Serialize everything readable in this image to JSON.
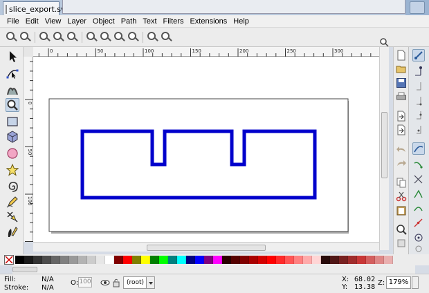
{
  "window": {
    "tab_title": "slice_export.svg"
  },
  "menu": [
    "File",
    "Edit",
    "View",
    "Layer",
    "Object",
    "Path",
    "Text",
    "Filters",
    "Extensions",
    "Help"
  ],
  "ruler": {
    "h_labels": [
      "0",
      "50",
      "100",
      "150",
      "200",
      "250",
      "300"
    ],
    "v_labels": [
      "0",
      "50",
      "100",
      "150",
      "200"
    ]
  },
  "colors": {
    "accent": "#c9d8ea",
    "shape_stroke": "#0000cc",
    "palette": [
      "#000000",
      "#1a1a1a",
      "#333333",
      "#4d4d4d",
      "#666666",
      "#808080",
      "#999999",
      "#b3b3b3",
      "#cccccc",
      "#e6e6e6",
      "#ffffff",
      "#800000",
      "#ff0000",
      "#808000",
      "#ffff00",
      "#008000",
      "#00ff00",
      "#008080",
      "#00ffff",
      "#000080",
      "#0000ff",
      "#800080",
      "#ff00ff",
      "#2b0000",
      "#550000",
      "#800000",
      "#aa0000",
      "#d40000",
      "#ff0000",
      "#ff2a2a",
      "#ff5555",
      "#ff8080",
      "#ffaaaa",
      "#ffd5d5",
      "#280b0b",
      "#501616",
      "#782121",
      "#a02c2c",
      "#c83737",
      "#d35f5f",
      "#de8787",
      "#e9afaf"
    ]
  },
  "icons": {
    "toolbox": [
      "selector-arrow-icon",
      "node-editor-icon",
      "tweak-icon",
      "zoom-icon",
      "rectangle-icon",
      "box3d-icon",
      "ellipse-icon",
      "star-icon",
      "spiral-icon",
      "pencil-icon",
      "pen-icon",
      "calligraphy-icon"
    ],
    "commands": [
      "new-document-icon",
      "open-icon",
      "save-icon",
      "print-icon",
      "import-icon",
      "export-icon",
      "undo-icon",
      "redo-icon",
      "copy-icon",
      "cut-icon",
      "paste-icon",
      "zoom-selection-icon"
    ],
    "snap": [
      "snap-toggle-icon",
      "snap-bbox-icon",
      "snap-bbox-edge-icon",
      "snap-bbox-corner-icon",
      "snap-bbox-midpoint-icon",
      "snap-bbox-center-icon",
      "snap-nodes-icon",
      "snap-path-icon",
      "snap-intersection-icon",
      "snap-cusp-icon",
      "snap-smooth-icon",
      "snap-midpoint-icon",
      "snap-center-icon",
      "snap-rotation-icon"
    ]
  },
  "status": {
    "fill_label": "Fill:",
    "fill_value": "N/A",
    "stroke_label": "Stroke:",
    "stroke_value": "N/A",
    "opacity_label": "O:",
    "opacity_value": "100",
    "layer_value": "(root)",
    "x_label": "X:",
    "x_value": "68.02",
    "y_label": "Y:",
    "y_value": "13.38",
    "zoom_label": "Z:",
    "zoom_value": "179%"
  }
}
